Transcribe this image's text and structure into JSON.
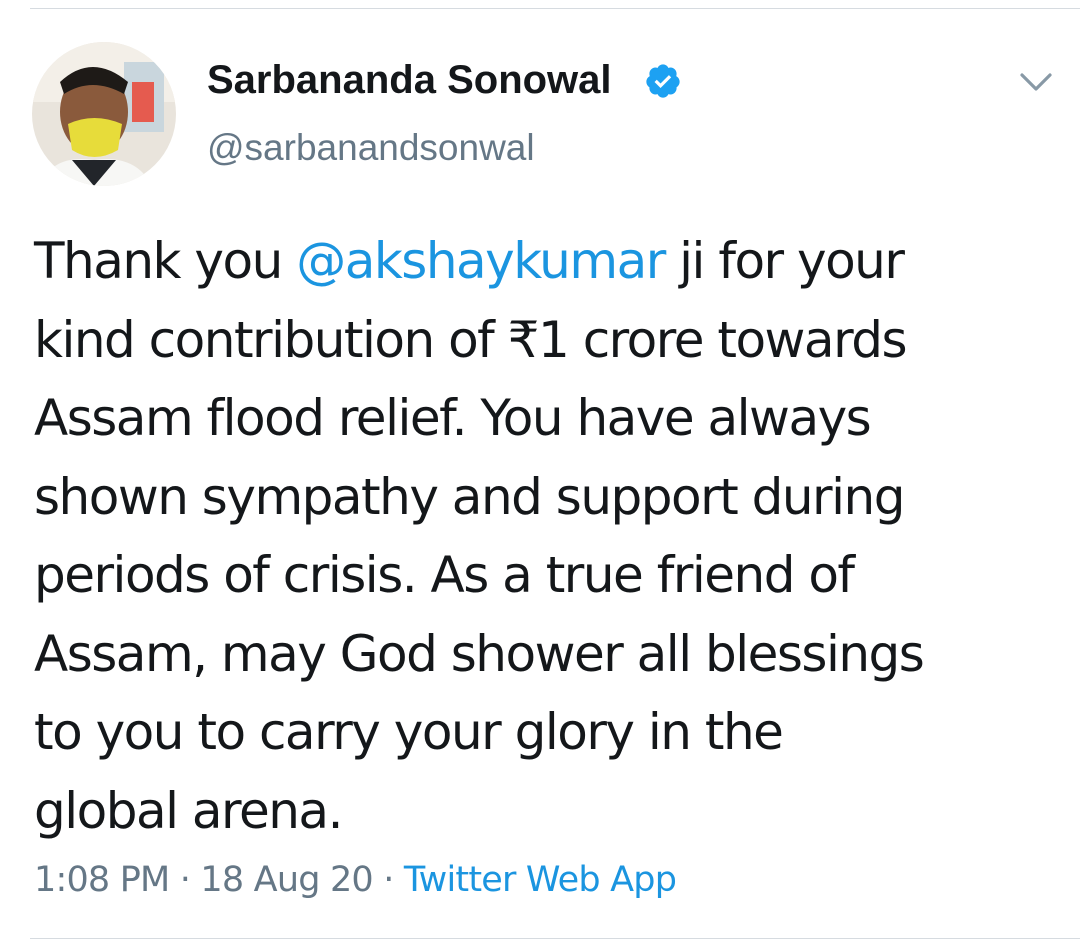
{
  "author": {
    "display_name": "Sarbananda Sonowal",
    "handle": "@sarbanandsonwal",
    "verified": true
  },
  "tweet": {
    "lines": [
      {
        "before": "Thank you ",
        "mention": "@akshaykumar",
        "after": " ji for your"
      },
      {
        "text": "kind contribution of ₹1 crore towards"
      },
      {
        "text": "Assam flood relief. You have always"
      },
      {
        "text": "shown sympathy and support during"
      },
      {
        "text": "periods of crisis. As a true friend of"
      },
      {
        "text": "Assam, may God shower all blessings"
      },
      {
        "text": "to you to carry your glory in the"
      },
      {
        "text": "global arena."
      }
    ]
  },
  "meta": {
    "time": "1:08 PM",
    "separator": " · ",
    "date": "18 Aug 20",
    "source": "Twitter Web App"
  },
  "icons": {
    "verified": "verified-badge-icon",
    "menu": "chevron-down-icon"
  },
  "colors": {
    "link": "#1b95e0",
    "text": "#14171a",
    "secondary": "#657786",
    "verified": "#1da1f2"
  }
}
